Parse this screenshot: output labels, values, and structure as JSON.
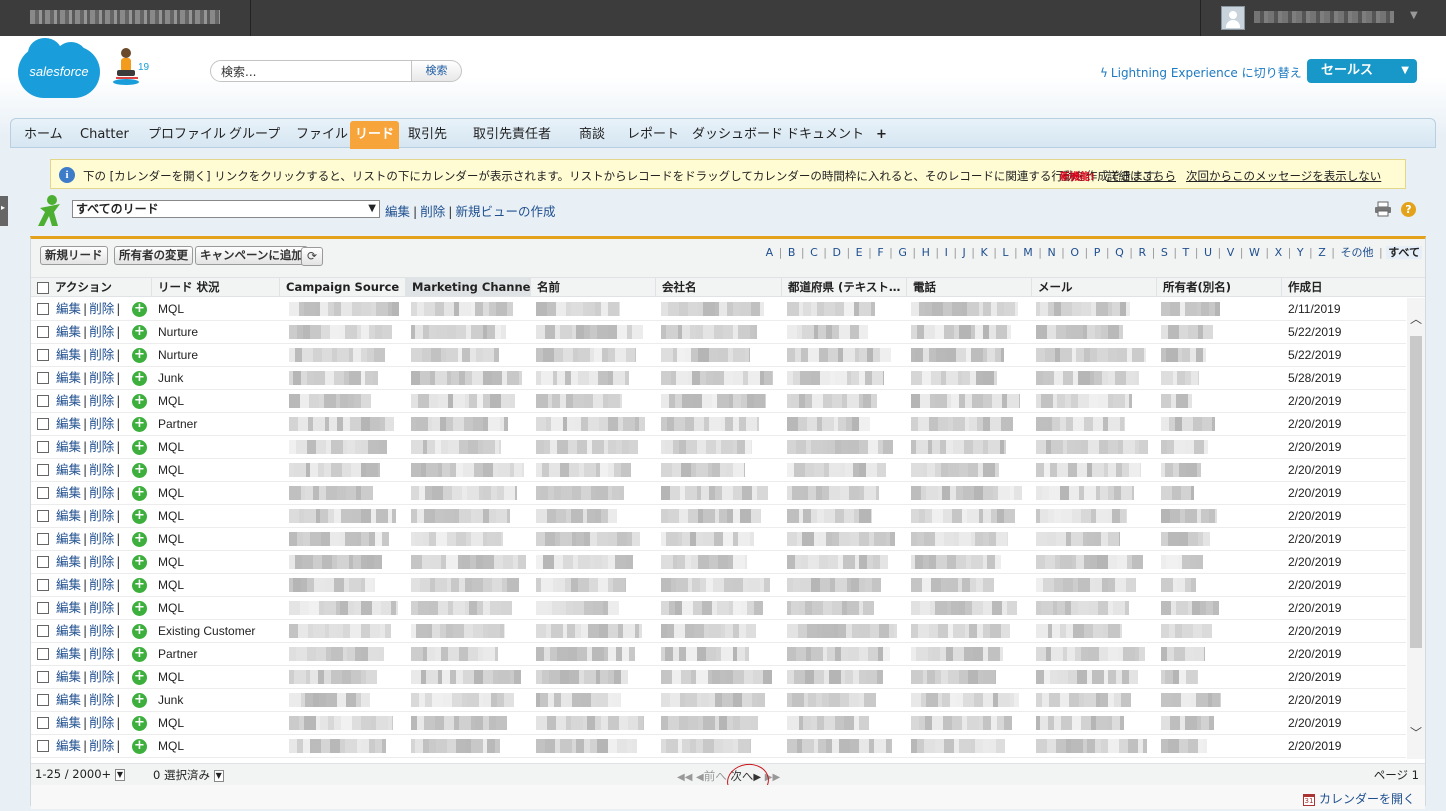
{
  "header": {
    "logo_text": "salesforce",
    "release_badge": "19",
    "search_placeholder": "検索...",
    "search_button": "検索",
    "lightning_link": "Lightning Experience に切り替え",
    "app_menu": "セールス"
  },
  "tabs": [
    "ホーム",
    "Chatter",
    "プロファイル",
    "グループ",
    "ファイル",
    "リード",
    "取引先",
    "取引先責任者",
    "商談",
    "レポート",
    "ダッシュボード",
    "ドキュメント",
    "+"
  ],
  "active_tab": "リード",
  "banner": {
    "message": "下の [カレンダーを開く] リンクをクリックすると、リストの下にカレンダーが表示されます。リストからレコードをドラッグしてカレンダーの時間枠に入れると、そのレコードに関連する行動を作成できます。",
    "new_label": "新機能!",
    "details_link": "詳細はこちら",
    "dismiss_link": "次回からこのメッセージを表示しない"
  },
  "view": {
    "selected": "すべてのリード",
    "edit": "編集",
    "delete": "削除",
    "create": "新規ビューの作成"
  },
  "toolbar": {
    "new_lead": "新規リード",
    "change_owner": "所有者の変更",
    "add_campaign": "キャンペーンに追加"
  },
  "alpha_filter": [
    "A",
    "B",
    "C",
    "D",
    "E",
    "F",
    "G",
    "H",
    "I",
    "J",
    "K",
    "L",
    "M",
    "N",
    "O",
    "P",
    "Q",
    "R",
    "S",
    "T",
    "U",
    "V",
    "W",
    "X",
    "Y",
    "Z",
    "その他",
    "すべて"
  ],
  "columns": [
    "アクション",
    "リード 状況",
    "Campaign Source",
    "Marketing Channel…",
    "名前",
    "会社名",
    "都道府県 (テキスト…",
    "電話",
    "メール",
    "所有者(別名)",
    "作成日"
  ],
  "row_actions": {
    "edit": "編集",
    "delete": "削除"
  },
  "rows": [
    {
      "status": "MQL",
      "date": "2/11/2019"
    },
    {
      "status": "Nurture",
      "date": "5/22/2019"
    },
    {
      "status": "Nurture",
      "date": "5/22/2019"
    },
    {
      "status": "Junk",
      "date": "5/28/2019"
    },
    {
      "status": "MQL",
      "date": "2/20/2019"
    },
    {
      "status": "Partner",
      "date": "2/20/2019"
    },
    {
      "status": "MQL",
      "date": "2/20/2019"
    },
    {
      "status": "MQL",
      "date": "2/20/2019"
    },
    {
      "status": "MQL",
      "date": "2/20/2019"
    },
    {
      "status": "MQL",
      "date": "2/20/2019"
    },
    {
      "status": "MQL",
      "date": "2/20/2019"
    },
    {
      "status": "MQL",
      "date": "2/20/2019"
    },
    {
      "status": "MQL",
      "date": "2/20/2019"
    },
    {
      "status": "MQL",
      "date": "2/20/2019"
    },
    {
      "status": "Existing Customer",
      "date": "2/20/2019"
    },
    {
      "status": "Partner",
      "date": "2/20/2019"
    },
    {
      "status": "MQL",
      "date": "2/20/2019"
    },
    {
      "status": "Junk",
      "date": "2/20/2019"
    },
    {
      "status": "MQL",
      "date": "2/20/2019"
    },
    {
      "status": "MQL",
      "date": "2/20/2019"
    }
  ],
  "footer": {
    "record_range": "1-25 / 2000+",
    "selected": "0 選択済み",
    "prev": "前へ",
    "next": "次へ",
    "page": "ページ 1"
  },
  "calendar_link": "カレンダーを開く",
  "colors": {
    "tab_active": "#f7a43a",
    "accent_border": "#e3a21a",
    "link": "#1f4f8f",
    "app_menu": "#1798c9",
    "annotation_circle": "#c8161d"
  }
}
